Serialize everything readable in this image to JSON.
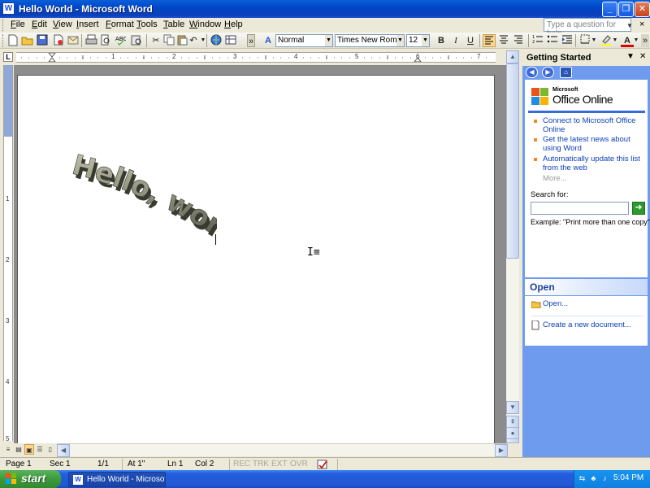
{
  "window": {
    "title": "Hello World - Microsoft Word",
    "app_icon_letter": "W",
    "minimize": "_",
    "maximize": "❐",
    "close": "✕"
  },
  "menu": {
    "items": [
      {
        "label": "File",
        "underline": "F",
        "rest": "ile"
      },
      {
        "label": "Edit",
        "underline": "E",
        "rest": "dit"
      },
      {
        "label": "View",
        "underline": "V",
        "rest": "iew"
      },
      {
        "label": "Insert",
        "underline": "I",
        "rest": "nsert"
      },
      {
        "label": "Format",
        "underline": "F",
        "rest": "ormat"
      },
      {
        "label": "Tools",
        "underline": "T",
        "rest": "ools"
      },
      {
        "label": "Table",
        "underline": "T",
        "rest": "able"
      },
      {
        "label": "Window",
        "underline": "W",
        "rest": "indow"
      },
      {
        "label": "Help",
        "underline": "H",
        "rest": "elp"
      }
    ],
    "help_placeholder": "Type a question for help",
    "doc_close": "×"
  },
  "toolbar": {
    "style": "Normal",
    "font": "Times New Roman",
    "size": "12",
    "bold": "B",
    "italic": "I",
    "underline": "U"
  },
  "ruler": {
    "h_numbers": [
      "1",
      "2",
      "3",
      "4",
      "5",
      "6",
      "7"
    ],
    "v_numbers": [
      "1",
      "2",
      "3",
      "4",
      "5"
    ],
    "tab_selector": "L"
  },
  "document": {
    "wordart_text": "Hello, world!",
    "ibeam": "I≡"
  },
  "statusbar": {
    "page": "Page 1",
    "sec": "Sec 1",
    "pages": "1/1",
    "at": "At 1\"",
    "ln": "Ln 1",
    "col": "Col 2",
    "rec": "REC",
    "trk": "TRK",
    "ext": "EXT",
    "ovr": "OVR"
  },
  "taskpane": {
    "title": "Getting Started",
    "logo_small": "Microsoft",
    "logo_big": "Office Online",
    "links": [
      "Connect to Microsoft Office Online",
      "Get the latest news about using Word",
      "Automatically update this list from the web"
    ],
    "more": "More...",
    "search_label": "Search for:",
    "search_value": "",
    "example": "Example:  \"Print more than one copy\"",
    "open_heading": "Open",
    "open_link": "Open...",
    "create_link": "Create a new document..."
  },
  "taskbar": {
    "start": "start",
    "task_button": "Hello World - Microsof...",
    "clock": "5:04 PM"
  }
}
